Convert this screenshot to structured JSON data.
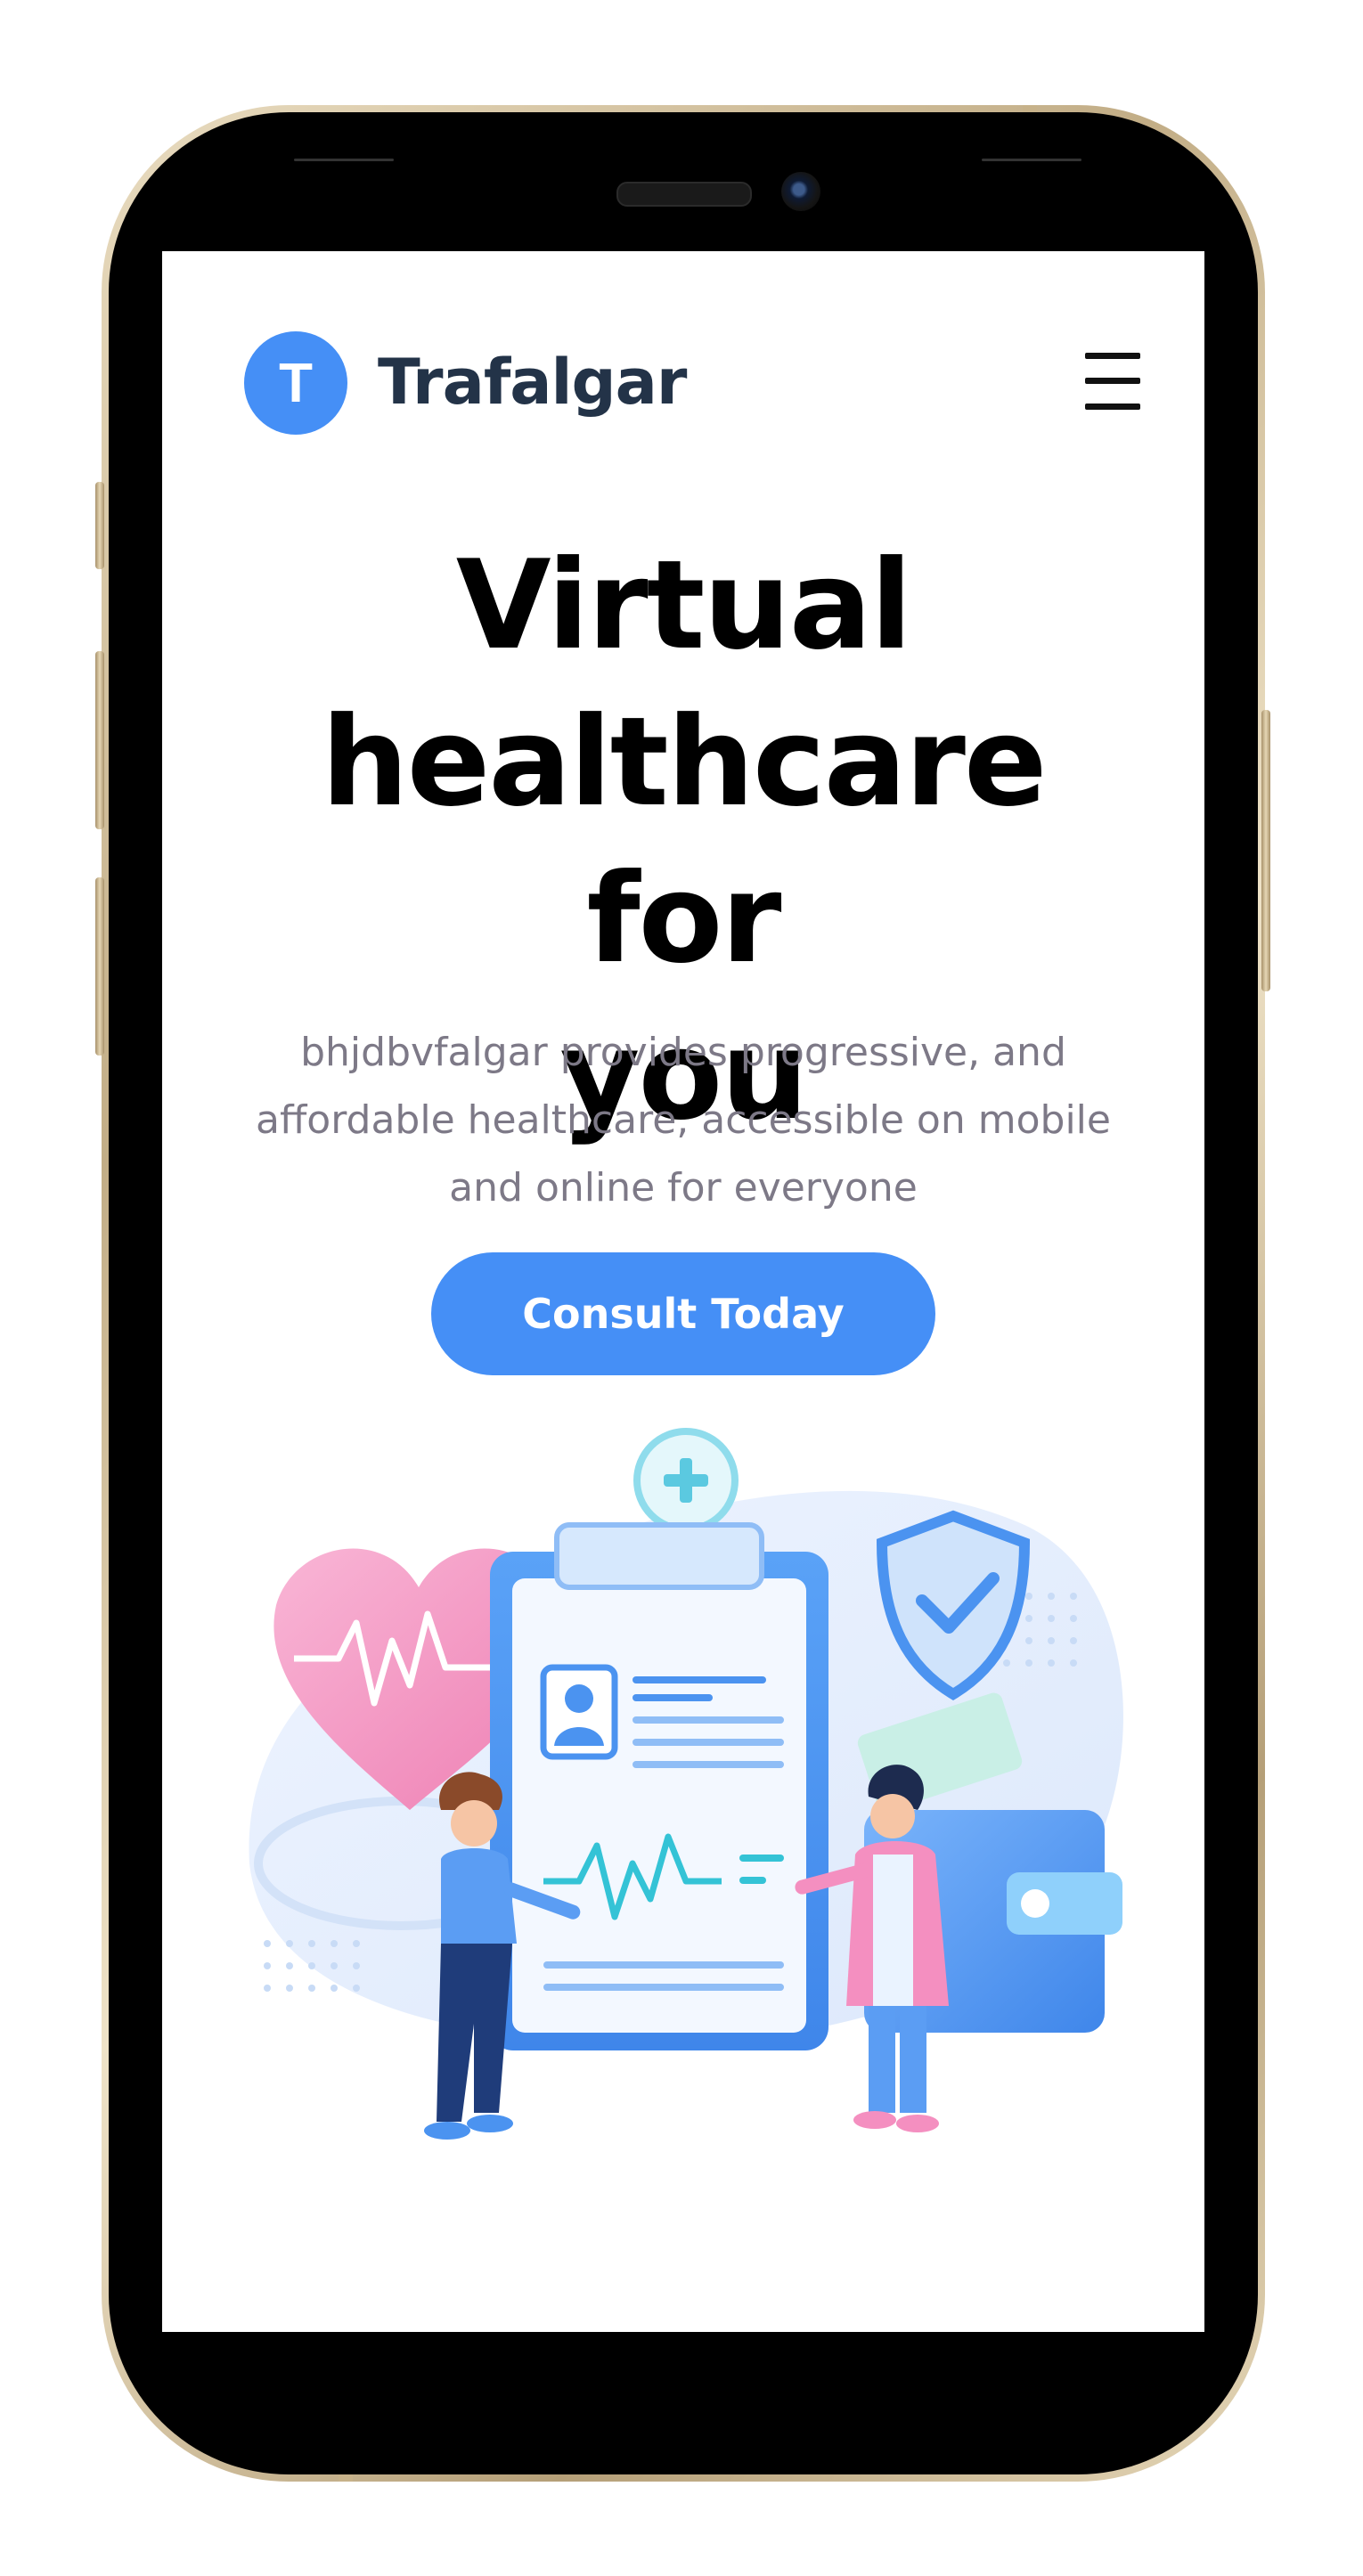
{
  "brand": {
    "logo_letter": "T",
    "name": "Trafalgar"
  },
  "nav": {
    "menu_icon": "hamburger-menu-icon"
  },
  "hero": {
    "title_lines": [
      "Virtual",
      "healthcare for",
      "you"
    ],
    "subtitle_lines": [
      "bhjdbvfalgar provides progressive, and",
      "affordable healthcare, accessible on mobile",
      "and online for everyone"
    ],
    "cta_label": "Consult Today"
  },
  "colors": {
    "accent": "#458ff6",
    "brand_text": "#233348",
    "subtitle": "#7d7987",
    "heart": "#f48fc0"
  }
}
